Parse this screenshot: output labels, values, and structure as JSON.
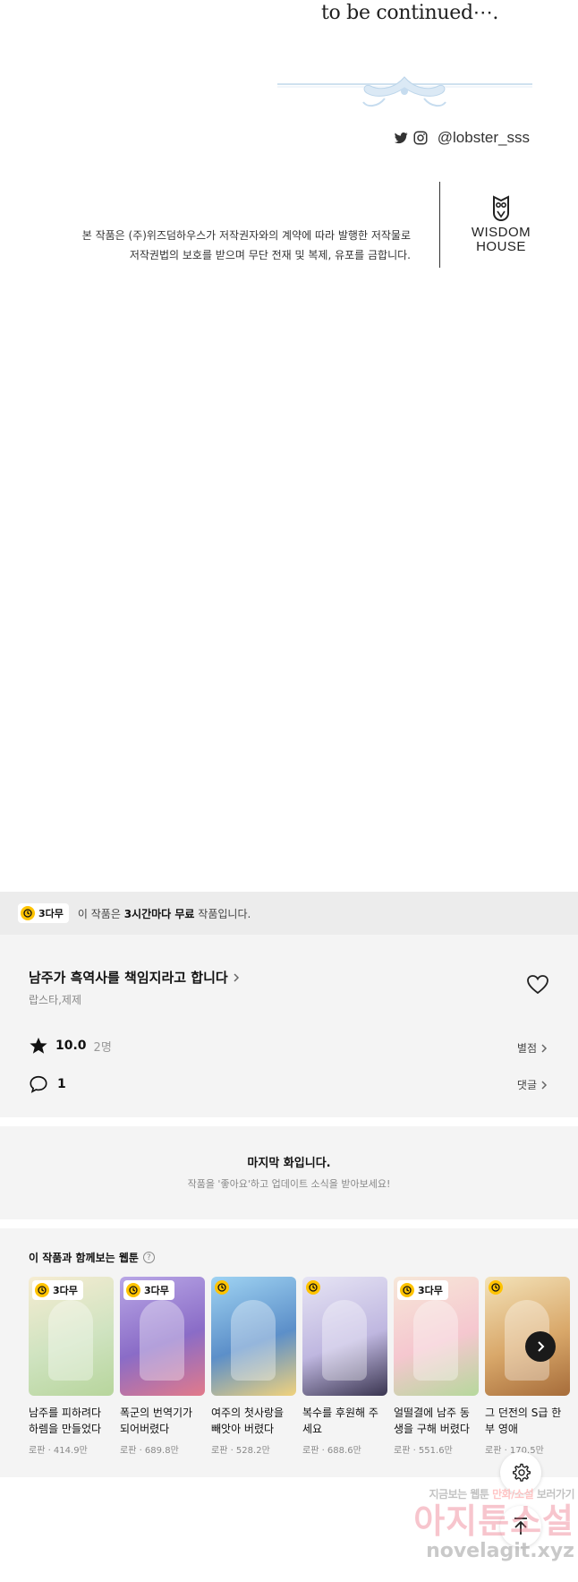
{
  "comic": {
    "to_be_continued": "to be continued⋯.",
    "social_handle": "@lobster_sss",
    "copyright_line1": "본 작품은 (주)위즈덤하우스가 저작권자와의 계약에 따라 발행한 저작물로",
    "copyright_line2": "저작권법의 보호를 받으며 무단 전재 및 복제, 유포를 금합니다.",
    "publisher_line1": "WISDOM",
    "publisher_line2": "HOUSE"
  },
  "free_banner": {
    "badge": "3다무",
    "text_prefix": "이 작품은 ",
    "text_bold": "3시간마다 무료",
    "text_suffix": " 작품입니다."
  },
  "series": {
    "title": "남주가 흑역사를 책임지라고 합니다",
    "authors": "랍스타,제제",
    "rating": "10.0",
    "rating_count": "2명",
    "rating_link": "별점",
    "comment_count": "1",
    "comment_link": "댓글"
  },
  "last_episode": {
    "title": "마지막 화입니다.",
    "subtitle": "작품을 '좋아요'하고 업데이트 소식을 받아보세요!"
  },
  "recommendations": {
    "heading": "이 작품과 함께보는 웹툰",
    "items": [
      {
        "title": "남주를 피하려다 하렘을 만들었다",
        "meta": "로판 · 414.9만",
        "badge": "3다무",
        "colors": [
          "#f6ecd2",
          "#cfe3c0",
          "#b7d59c"
        ]
      },
      {
        "title": "폭군의 번역기가 되어버렸다",
        "meta": "로판 · 689.8만",
        "badge": "3다무",
        "colors": [
          "#b9a7e6",
          "#8a6cc7",
          "#e27a8a"
        ]
      },
      {
        "title": "여주의 첫사랑을 빼앗아 버렸다",
        "meta": "로판 · 528.2만",
        "badge": "",
        "colors": [
          "#9fd3f2",
          "#5c8fc9",
          "#f1d27c"
        ]
      },
      {
        "title": "복수를 후원해 주세요",
        "meta": "로판 · 688.6만",
        "badge": "",
        "colors": [
          "#e6e4f4",
          "#bfb7e0",
          "#3a3550"
        ]
      },
      {
        "title": "얼떨결에 남주 동생을 구해 버렸다",
        "meta": "로판 · 551.6만",
        "badge": "3다무",
        "colors": [
          "#f6e7d8",
          "#f5c7cf",
          "#b6d89c"
        ]
      },
      {
        "title": "그 던전의 S급 한부 영애",
        "meta": "로판 · 170.5만",
        "badge": "",
        "colors": [
          "#f3e2b8",
          "#d9a86a",
          "#a66c3a"
        ]
      }
    ]
  },
  "watermark": {
    "line1_a": "지금보는 웹툰",
    "line1_b": "만화/소설",
    "line1_c": "보러가기",
    "line2": "아지툰소설",
    "line3": "novelagit.xyz"
  }
}
